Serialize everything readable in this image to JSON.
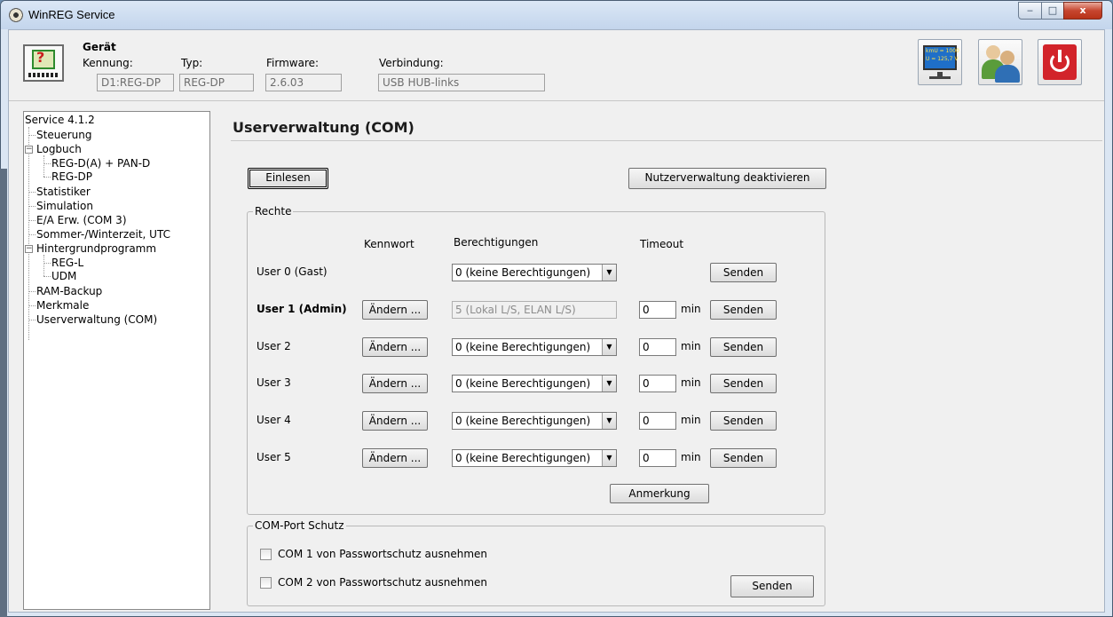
{
  "window": {
    "title": "WinREG Service",
    "btn_min": "‒",
    "btn_max": "□",
    "btn_close": "x"
  },
  "header": {
    "geraet": "Gerät",
    "kennung_label": "Kennung:",
    "kennung_value": "D1:REG-DP",
    "typ_label": "Typ:",
    "typ_value": "REG-DP",
    "firmware_label": "Firmware:",
    "firmware_value": "2.6.03",
    "verbindung_label": "Verbindung:",
    "verbindung_value": "USB HUB-links",
    "monitor_line1": "kmU = 1000",
    "monitor_line2": "U = 125,7 V"
  },
  "tree": {
    "root": "Service 4.1.2",
    "items": [
      "Steuerung",
      "Logbuch",
      "REG-D(A) + PAN-D",
      "REG-DP",
      "Statistiker",
      "Simulation",
      "E/A Erw. (COM 3)",
      "Sommer-/Winterzeit, UTC",
      "Hintergrundprogramm",
      "REG-L",
      "UDM",
      "RAM-Backup",
      "Merkmale",
      "Userverwaltung (COM)"
    ]
  },
  "main": {
    "title": "Userverwaltung (COM)",
    "einlesen": "Einlesen",
    "deactivate": "Nutzerverwaltung deaktivieren",
    "rechte": {
      "legend": "Rechte",
      "col_kennwort": "Kennwort",
      "col_berechtigungen": "Berechtigungen",
      "col_timeout": "Timeout",
      "aendern": "Ändern ...",
      "senden": "Senden",
      "min": "min",
      "users": [
        {
          "name": "User 0 (Gast)",
          "perm": "0 (keine Berechtigungen)"
        },
        {
          "name": "User 1 (Admin)",
          "perm": "5 (Lokal L/S, ELAN L/S)",
          "timeout": "0"
        },
        {
          "name": "User 2",
          "perm": "0 (keine Berechtigungen)",
          "timeout": "0"
        },
        {
          "name": "User 3",
          "perm": "0 (keine Berechtigungen)",
          "timeout": "0"
        },
        {
          "name": "User 4",
          "perm": "0 (keine Berechtigungen)",
          "timeout": "0"
        },
        {
          "name": "User 5",
          "perm": "0 (keine Berechtigungen)",
          "timeout": "0"
        }
      ],
      "anmerkung": "Anmerkung"
    },
    "com": {
      "legend": "COM-Port Schutz",
      "com1": "COM 1 von Passwortschutz ausnehmen",
      "com2": "COM 2 von Passwortschutz ausnehmen",
      "senden": "Senden"
    }
  }
}
